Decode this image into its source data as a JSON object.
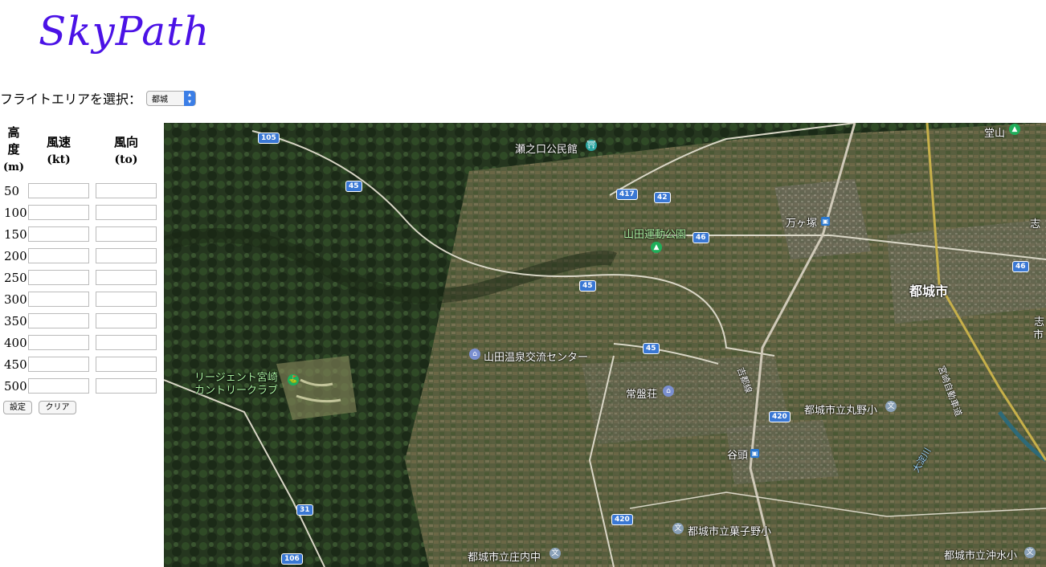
{
  "app": {
    "title": "SkyPath"
  },
  "area": {
    "label": "フライトエリアを選択：",
    "selected": "都城"
  },
  "table": {
    "headers": {
      "altitude": [
        "高",
        "度",
        "(m)"
      ],
      "wind_speed": [
        "風速",
        "(kt)"
      ],
      "wind_dir": [
        "風向",
        "(to)"
      ]
    },
    "altitudes": [
      "50",
      "100",
      "150",
      "200",
      "250",
      "300",
      "350",
      "400",
      "450",
      "500"
    ]
  },
  "buttons": {
    "set": "設定",
    "clear": "クリア"
  },
  "map": {
    "places": [
      "瀬之口公民館",
      "山田運動公園",
      "万ヶ塚",
      "都城市",
      "山田温泉交流センター",
      "リージェント宮崎",
      "カントリークラブ",
      "常盤荘",
      "都城市立丸野小",
      "谷頭",
      "都城市立菓子野小",
      "都城市立庄内中",
      "都城市立沖水小",
      "堂山",
      "宮崎自動車道",
      "吉都線",
      "志",
      "志",
      "市",
      "大淀川"
    ],
    "routes": [
      "105",
      "45",
      "417",
      "42",
      "46",
      "46",
      "45",
      "45",
      "420",
      "31",
      "420",
      "106"
    ]
  }
}
